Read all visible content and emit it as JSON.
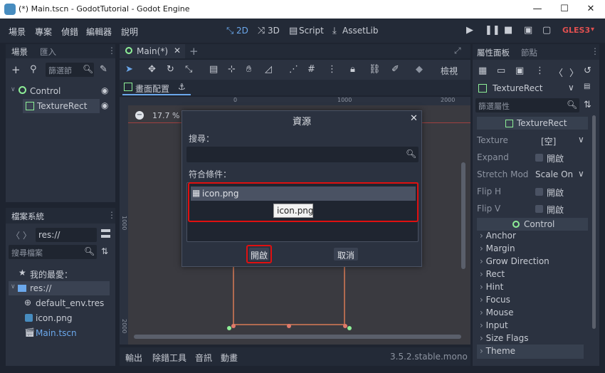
{
  "window": {
    "title": "(*) Main.tscn - GodotTutorial - Godot Engine",
    "controls": {
      "minimize": "—",
      "maximize": "☐",
      "close": "✕"
    }
  },
  "menubar": {
    "items": [
      "場景",
      "專案",
      "偵錯",
      "編輯器",
      "說明"
    ],
    "modes": [
      "2D",
      "3D",
      "Script",
      "AssetLib"
    ],
    "renderer": "GLES3"
  },
  "scene_dock": {
    "tabs": [
      "場景",
      "匯入"
    ],
    "filter_placeholder": "篩選節",
    "nodes": [
      {
        "label": "Control"
      },
      {
        "label": "TextureRect"
      }
    ]
  },
  "filesystem_dock": {
    "title": "檔案系統",
    "path": "res://",
    "search_placeholder": "搜尋檔案",
    "items": [
      {
        "label": "我的最愛："
      },
      {
        "label": "res://"
      },
      {
        "label": "default_env.tres"
      },
      {
        "label": "icon.png"
      },
      {
        "label": "Main.tscn"
      }
    ]
  },
  "editor": {
    "tab_label": "Main(*)",
    "view_btn": "檢視",
    "layout_label": "畫面配置",
    "zoom": "17.7 %",
    "ruler_labels": [
      "0",
      "1000",
      "2000"
    ],
    "vruler_labels": [
      "1000",
      "2000"
    ],
    "bottom_tabs": [
      "輸出",
      "除錯工具",
      "音訊",
      "動畫"
    ],
    "version": "3.5.2.stable.mono"
  },
  "dialog": {
    "title": "資源",
    "search_label": "搜尋：",
    "search_value": "",
    "matches_label": "符合條件：",
    "result": "icon.png",
    "tooltip": "icon.png",
    "open_btn": "開啟",
    "cancel_btn": "取消"
  },
  "inspector": {
    "tabs": [
      "屬性面板",
      "節點"
    ],
    "node_type": "TextureRect",
    "filter_placeholder": "篩選屬性",
    "section_header": "TextureRect",
    "properties": [
      {
        "name": "Texture",
        "value": "[空]"
      },
      {
        "name": "Expand",
        "value": "開啟"
      },
      {
        "name": "Stretch Mod",
        "value": "Scale On"
      },
      {
        "name": "Flip H",
        "value": "開啟"
      },
      {
        "name": "Flip V",
        "value": "開啟"
      }
    ],
    "control_header": "Control",
    "groups": [
      "Anchor",
      "Margin",
      "Grow Direction",
      "Rect",
      "Hint",
      "Focus",
      "Mouse",
      "Input",
      "Size Flags",
      "Theme"
    ]
  },
  "colors": {
    "accent": "#6ba8ec",
    "highlight": "#e01010",
    "bg": "#1e2430",
    "panel": "#2b3240"
  }
}
